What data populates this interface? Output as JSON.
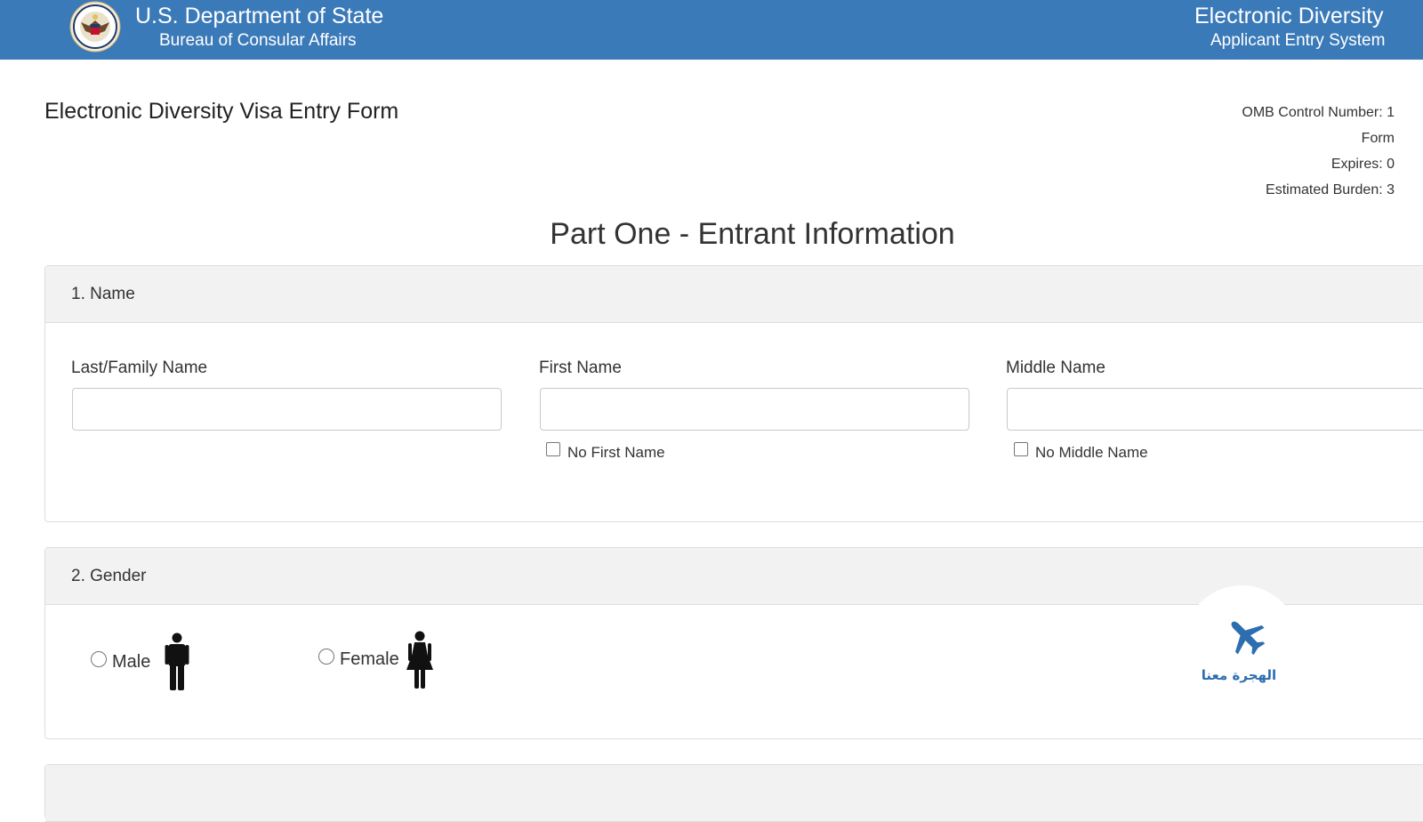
{
  "header": {
    "title": "U.S. Department of State",
    "subtitle": "Bureau of Consular Affairs",
    "right_title": "Electronic Diversity",
    "right_subtitle": "Applicant Entry System"
  },
  "form_title": "Electronic Diversity Visa Entry Form",
  "omb": {
    "control": "OMB Control Number: 1",
    "form": "Form",
    "expires": "Expires: 0",
    "burden": "Estimated Burden: 3"
  },
  "part_title": "Part One - Entrant Information",
  "name_section": {
    "heading": "1. Name",
    "last_label": "Last/Family Name",
    "last_value": "",
    "first_label": "First Name",
    "first_value": "",
    "middle_label": "Middle Name",
    "middle_value": "",
    "no_first": "No First Name",
    "no_middle": "No Middle Name"
  },
  "gender_section": {
    "heading": "2. Gender",
    "male": "Male",
    "female": "Female"
  },
  "watermark": {
    "text": "الهجرة معنا"
  },
  "colors": {
    "header_bg": "#3b7ab9",
    "panel_head_bg": "#f2f2f2",
    "watermark_blue": "#2d6db0"
  },
  "icons": [
    "department-seal-icon",
    "male-figure-icon",
    "female-figure-icon",
    "airplane-icon"
  ]
}
